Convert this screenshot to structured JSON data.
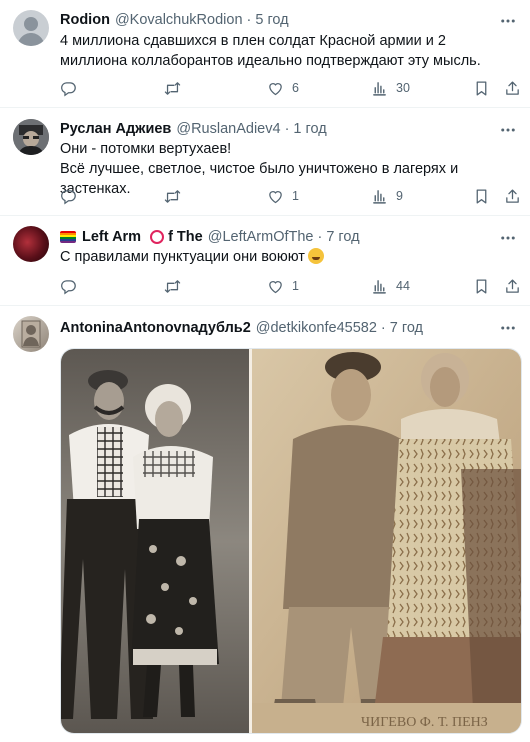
{
  "tweets": [
    {
      "name": "Rodion",
      "handle": "@KovalchukRodion",
      "time": "5 год",
      "text": "4 миллиона сдавшихся в плен солдат Красной армии и 2 миллиона коллаборантов идеально подтверждают эту мысль.",
      "likes": "6",
      "views": "30"
    },
    {
      "name": "Руслан Аджиев",
      "handle": "@RuslanAdiev4",
      "time": "1 год",
      "text_line1": "Они - потомки вертухаев!",
      "text_line2": "Всё лучшее, светлое, чистое было уничтожено в лагерях и застенках.",
      "likes": "1",
      "views": "9"
    },
    {
      "name_part1": "Left Arm",
      "name_part2": "f The",
      "handle": "@LeftArmOfThe",
      "time": "7 год",
      "text": "С правилами пунктуации они воюют",
      "likes": "1",
      "views": "44"
    },
    {
      "name": "AntoninaAntonovnaдубль2",
      "handle": "@detkikonfe45582",
      "time": "7 год",
      "photo_caption": "ЧИГЕВО Ф. Т. ПЕНЗ"
    }
  ],
  "icons": [
    "reply-icon",
    "retweet-icon",
    "like-icon",
    "views-icon",
    "bookmark-icon",
    "share-icon",
    "more-icon"
  ],
  "colors": {
    "text": "#0f1419",
    "secondary": "#536471",
    "divider": "#eff3f4"
  }
}
